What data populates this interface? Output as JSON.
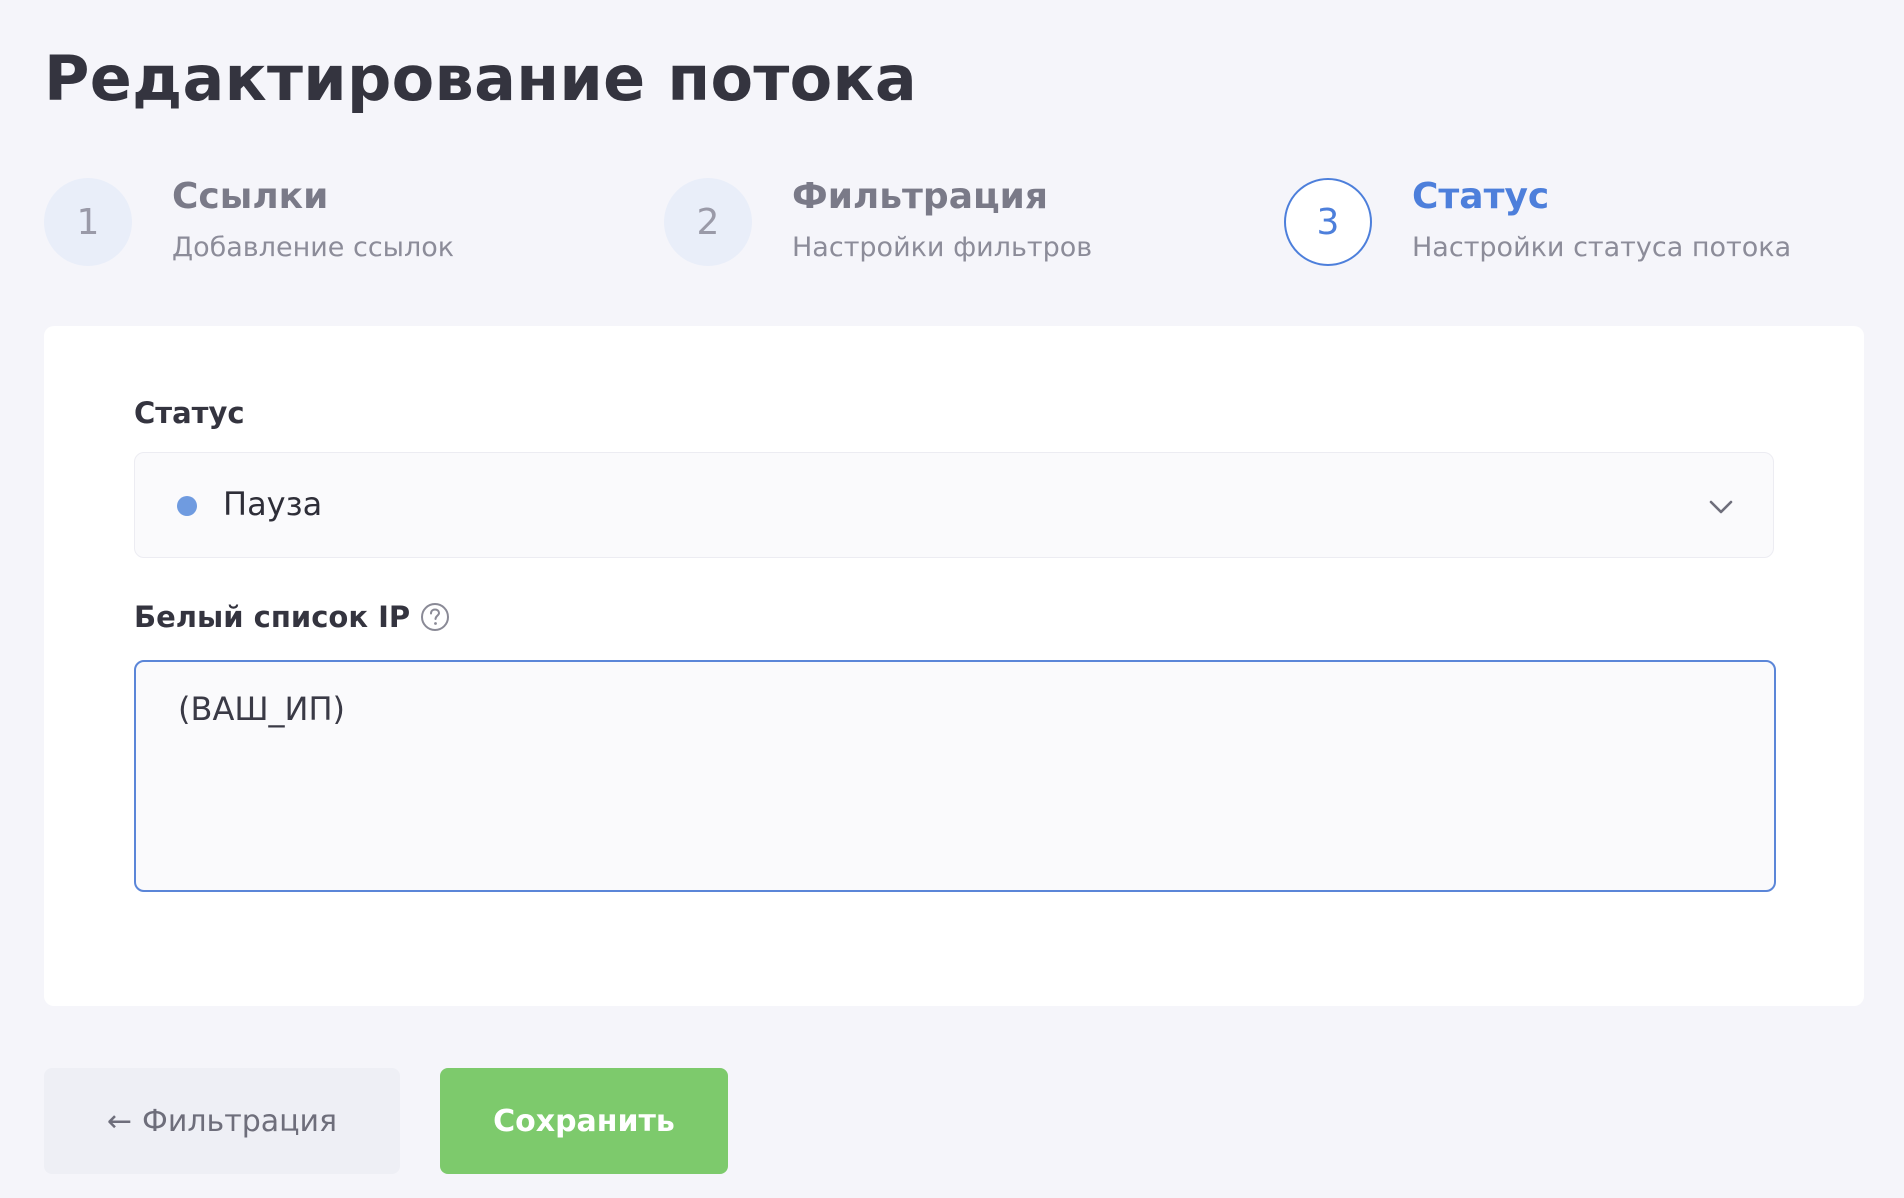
{
  "page": {
    "title": "Редактирование потока"
  },
  "steps": [
    {
      "number": "1",
      "title": "Ссылки",
      "subtitle": "Добавление ссылок",
      "active": false
    },
    {
      "number": "2",
      "title": "Фильтрация",
      "subtitle": "Настройки фильтров",
      "active": false
    },
    {
      "number": "3",
      "title": "Статус",
      "subtitle": "Настройки статуса потока",
      "active": true
    }
  ],
  "form": {
    "status_label": "Статус",
    "status_value": "Пауза",
    "status_dot_color": "#6f9be0",
    "whitelist_label": "Белый список IP",
    "whitelist_value": "(ВАШ_ИП)",
    "help_icon": "question-circle-icon"
  },
  "actions": {
    "back_arrow": "←",
    "back_label": "Фильтрация",
    "save_label": "Сохранить"
  },
  "colors": {
    "accent": "#4d7fdb",
    "save": "#7dca6c",
    "background": "#f5f5fa"
  }
}
